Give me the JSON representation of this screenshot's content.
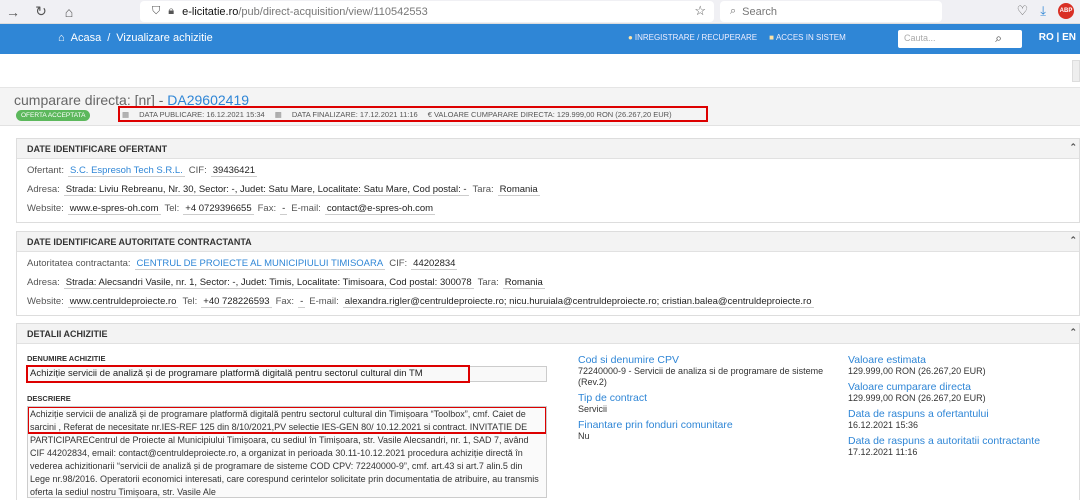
{
  "browser": {
    "url_host": "e-licitatie.ro",
    "url_path": "/pub/direct-acquisition/view/110542553",
    "search_placeholder": "Search",
    "ext_label": "ABP"
  },
  "topbar": {
    "home": "Acasa",
    "sep": "/",
    "page": "Vizualizare achizitie",
    "register": "INREGISTRARE / RECUPERARE",
    "login": "ACCES IN SISTEM",
    "search_placeholder": "Cauta...",
    "lang": "RO | EN"
  },
  "header": {
    "title_prefix": "cumparare directa: [nr] - ",
    "title_id": "DA29602419",
    "status": "OFERTA ACCEPTATA",
    "pub_date": "DATA PUBLICARE: 16.12.2021 15:34",
    "fin_date": "DATA FINALIZARE: 17.12.2021 11:16",
    "value": "€ VALOARE CUMPARARE DIRECTA: 129.999,00  RON (26.267,20  EUR)"
  },
  "ofertant": {
    "heading": "DATE IDENTIFICARE OFERTANT",
    "ofertant_label": "Ofertant:",
    "ofertant_value": "S.C. Espresoh Tech S.R.L.",
    "cif_label": "CIF:",
    "cif_value": "39436421",
    "adresa_label": "Adresa:",
    "adresa_value": "Strada: Liviu Rebreanu, Nr. 30, Sector: -, Judet: Satu Mare, Localitate: Satu Mare, Cod postal: -",
    "tara_label": "Tara:",
    "tara_value": "Romania",
    "website_label": "Website:",
    "website_value": "www.e-spres-oh.com",
    "tel_label": "Tel:",
    "tel_value": "+4 0729396655",
    "fax_label": "Fax:",
    "fax_value": "-",
    "email_label": "E-mail:",
    "email_value": "contact@e-spres-oh.com"
  },
  "autoritate": {
    "heading": "DATE IDENTIFICARE AUTORITATE CONTRACTANTA",
    "aut_label": "Autoritatea contractanta:",
    "aut_value": "CENTRUL DE PROIECTE AL MUNICIPIULUI TIMISOARA",
    "cif_label": "CIF:",
    "cif_value": "44202834",
    "adresa_label": "Adresa:",
    "adresa_value": "Strada: Alecsandri Vasile, nr. 1, Sector: -, Judet: Timis, Localitate: Timisoara, Cod postal: 300078",
    "tara_label": "Tara:",
    "tara_value": "Romania",
    "website_label": "Website:",
    "website_value": "www.centruldeproiecte.ro",
    "tel_label": "Tel:",
    "tel_value": "+40 728226593",
    "fax_label": "Fax:",
    "fax_value": "-",
    "email_label": "E-mail:",
    "email_value": "alexandra.rigler@centruldeproiecte.ro; nicu.huruiala@centruldeproiecte.ro; cristian.balea@centruldeproiecte.ro"
  },
  "detalii": {
    "heading": "DETALII ACHIZITIE",
    "denumire_label": "DENUMIRE ACHIZITIE",
    "denumire_value": "Achiziție servicii de analiză și de programare platformă digitală pentru sectorul cultural din TM",
    "descriere_label": "DESCRIERE",
    "descriere_value": "Achiziție servicii de analiză și de programare platformă digitală pentru sectorul cultural din Timișoara “Toolbox”, cmf. Caiet de sarcini , Referat de necesitate nr.IES-REF 125 din 8/10/2021,PV selectie IES-GEN 80/ 10.12.2021 si contract. INVITAȚIE DE PARTICIPARECentrul de Proiecte al Municipiului Timișoara, cu sediul în Timișoara, str. Vasile Alecsandri, nr. 1, SAD 7, având CIF 44202834, email: contact@centruldeproiecte.ro, a organizat in perioada 30.11-10.12.2021 procedura achiziție directă în vederea achizitionarii “servicii de analiză și de programare de sisteme COD CPV: 72240000-9”, cmf. art.43 si art.7 alin.5 din Lege nr.98/2016. Operatorii economici interesati, care corespund cerintelor solicitate prin documentatia de atribuire, au transmis oferta la sediul nostru Timișoara, str. Vasile Ale",
    "cpv_label": "Cod si denumire CPV",
    "cpv_value": "72240000-9 - Servicii de analiza si de programare de sisteme (Rev.2)",
    "tip_label": "Tip de contract",
    "tip_value": "Servicii",
    "fin_label": "Finantare prin fonduri comunitare",
    "fin_value": "Nu",
    "val_est_label": "Valoare estimata",
    "val_est_value": "129.999,00  RON (26.267,20  EUR)",
    "val_cump_label": "Valoare cumparare directa",
    "val_cump_value": "129.999,00  RON (26.267,20  EUR)",
    "data_ofert_label": "Data de raspuns a ofertantului",
    "data_ofert_value": "16.12.2021 15:36",
    "data_aut_label": "Data de raspuns a autoritatii contractante",
    "data_aut_value": "17.12.2021 11:16"
  }
}
